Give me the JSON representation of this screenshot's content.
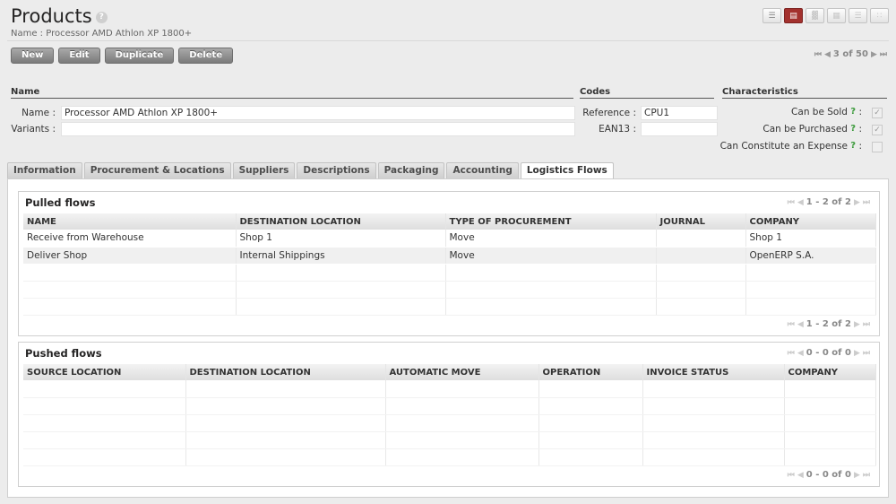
{
  "header": {
    "title": "Products",
    "help": "?",
    "subtitle": "Name : Processor AMD Athlon XP 1800+"
  },
  "view_switch": [
    "list-view-icon",
    "form-view-icon",
    "graph-view-icon",
    "calendar-view-icon",
    "gantt-view-icon",
    "kanban-view-icon"
  ],
  "toolbar": {
    "new": "New",
    "edit": "Edit",
    "duplicate": "Duplicate",
    "delete": "Delete"
  },
  "record_pager": {
    "text": "3 of 50"
  },
  "sections": {
    "name": "Name",
    "codes": "Codes",
    "characteristics": "Characteristics"
  },
  "fields": {
    "name_label": "Name :",
    "name_value": "Processor AMD Athlon XP 1800+",
    "variants_label": "Variants :",
    "variants_value": "",
    "reference_label": "Reference :",
    "reference_value": "CPU1",
    "ean13_label": "EAN13 :",
    "ean13_value": "",
    "can_be_sold_label": "Can be Sold",
    "can_be_purchased_label": "Can be Purchased",
    "can_constitute_expense_label": "Can Constitute an Expense",
    "qmark": "?",
    "colon": ":",
    "can_be_sold": true,
    "can_be_purchased": true,
    "can_constitute_expense": false
  },
  "tabs": [
    "Information",
    "Procurement & Locations",
    "Suppliers",
    "Descriptions",
    "Packaging",
    "Accounting",
    "Logistics Flows"
  ],
  "active_tab": "Logistics Flows",
  "pulled": {
    "title": "Pulled flows",
    "pager": "1 - 2 of 2",
    "columns": [
      "NAME",
      "DESTINATION LOCATION",
      "TYPE OF PROCUREMENT",
      "JOURNAL",
      "COMPANY"
    ],
    "rows": [
      [
        "Receive from Warehouse",
        "Shop 1",
        "Move",
        "",
        "Shop 1"
      ],
      [
        "Deliver Shop",
        "Internal Shippings",
        "Move",
        "",
        "OpenERP S.A."
      ]
    ]
  },
  "pushed": {
    "title": "Pushed flows",
    "pager": "0 - 0 of 0",
    "columns": [
      "SOURCE LOCATION",
      "DESTINATION LOCATION",
      "AUTOMATIC MOVE",
      "OPERATION",
      "INVOICE STATUS",
      "COMPANY"
    ],
    "rows": []
  }
}
